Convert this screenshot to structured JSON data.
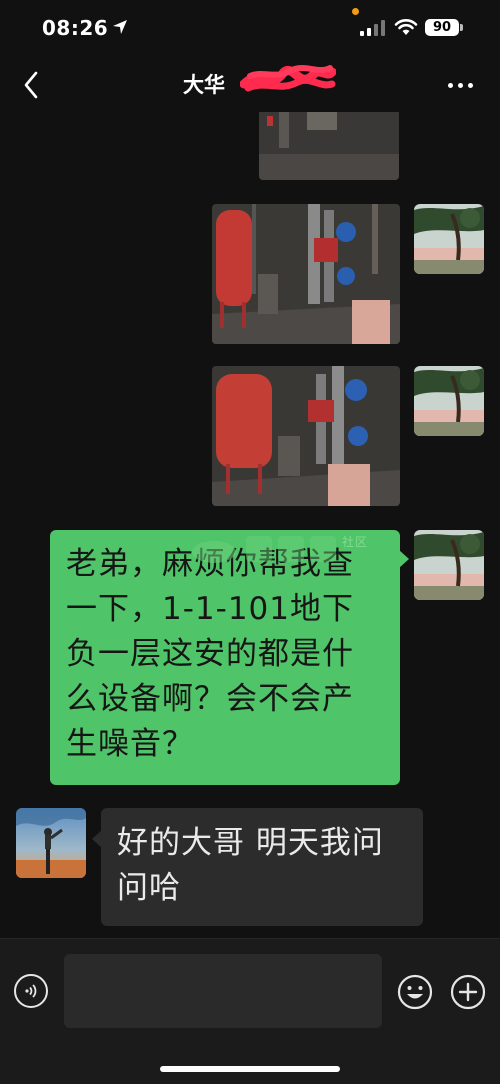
{
  "status_bar": {
    "time": "08:26",
    "battery": "90",
    "icons": [
      "location-arrow-icon",
      "signal-icon",
      "wifi-icon",
      "battery-icon"
    ]
  },
  "nav": {
    "title": "大华",
    "icons": [
      "chevron-left-icon",
      "more-icon"
    ]
  },
  "messages": [
    {
      "side": "outgoing",
      "type": "image",
      "content": "photo (partially visible)"
    },
    {
      "side": "outgoing",
      "type": "image",
      "content": "photo"
    },
    {
      "side": "outgoing",
      "type": "image",
      "content": "photo"
    },
    {
      "side": "outgoing",
      "type": "text",
      "text": "老弟，麻烦你帮我查一下，1-1-101地下负一层这安的都是什么设备啊？会不会产生噪音？"
    },
    {
      "side": "incoming",
      "type": "text",
      "text": "好的大哥 明天我问问哈"
    }
  ],
  "watermark": {
    "text": "社区"
  },
  "input_bar": {
    "placeholder": "",
    "icons": [
      "voice-icon",
      "emoji-icon",
      "plus-icon"
    ]
  },
  "colors": {
    "outgoing_bubble": "#4fc468",
    "incoming_bubble": "#2c2c2c",
    "background": "#111111"
  }
}
